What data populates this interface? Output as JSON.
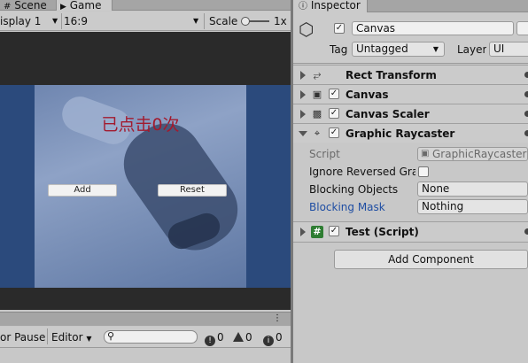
{
  "game_panel": {
    "tabs": [
      {
        "label": "Scene",
        "icon": "grid-icon"
      },
      {
        "label": "Game",
        "icon": "gamepad-icon"
      }
    ],
    "display": "isplay 1",
    "aspect": "16:9",
    "scale_label": "Scale",
    "scale_value": "1x",
    "game": {
      "label_text": "已点击0次",
      "add_button": "Add",
      "reset_button": "Reset"
    }
  },
  "console": {
    "error_pause": "or Pause",
    "editor_dropdown": "Editor",
    "search_placeholder": "",
    "counts": {
      "errors": "0",
      "warnings": "0",
      "messages": "0"
    }
  },
  "inspector": {
    "tab_label": "Inspector",
    "object_name": "Canvas",
    "tag_label": "Tag",
    "tag_value": "Untagged",
    "layer_label": "Layer",
    "layer_value": "UI",
    "components": [
      {
        "title": "Rect Transform",
        "icon": "rect-transform-icon"
      },
      {
        "title": "Canvas",
        "icon": "canvas-icon"
      },
      {
        "title": "Canvas Scaler",
        "icon": "canvas-scaler-icon"
      },
      {
        "title": "Graphic Raycaster",
        "icon": "raycaster-icon"
      },
      {
        "title": "Test (Script)",
        "icon": "script-icon"
      }
    ],
    "raycaster_fields": {
      "script_label": "Script",
      "script_value": "GraphicRaycaster",
      "ignore_label": "Ignore Reversed Grap",
      "blocking_objects_label": "Blocking Objects",
      "blocking_objects_value": "None",
      "blocking_mask_label": "Blocking Mask",
      "blocking_mask_value": "Nothing"
    },
    "add_component": "Add Component"
  },
  "colors": {
    "game_background": "#2b4a7c",
    "game_label": "#a21a2e",
    "blocking_mask_label": "#1f4ea3"
  }
}
